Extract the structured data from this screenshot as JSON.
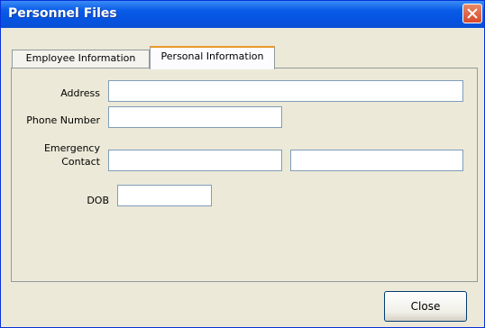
{
  "window": {
    "title": "Personnel Files"
  },
  "tabs": [
    {
      "label": "Employee Information"
    },
    {
      "label": "Personal Information"
    }
  ],
  "form": {
    "address_label": "Address",
    "address_value": "",
    "phone_label": "Phone Number",
    "phone_value": "",
    "emergency_label_line1": "Emergency",
    "emergency_label_line2": "Contact",
    "emergency_value_1": "",
    "emergency_value_2": "",
    "dob_label": "DOB",
    "dob_value": ""
  },
  "buttons": {
    "close_label": "Close"
  }
}
